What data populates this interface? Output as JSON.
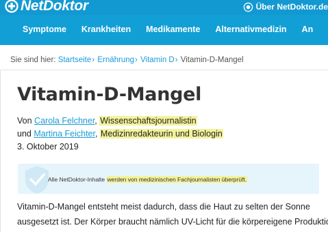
{
  "header": {
    "logo_text": "NetDoktor",
    "about_label": "Über NetDoktor.de"
  },
  "nav": {
    "home_icon": "home-icon",
    "items": [
      {
        "label": "Symptome"
      },
      {
        "label": "Krankheiten"
      },
      {
        "label": "Medikamente"
      },
      {
        "label": "Alternativmedizin"
      },
      {
        "label": "An"
      }
    ]
  },
  "breadcrumb": {
    "prefix": "Sie sind hier:",
    "links": [
      "Startseite",
      "Ernährung",
      "Vitamin D"
    ],
    "separator": "›",
    "current": "Vitamin-D-Mangel"
  },
  "article": {
    "title": "Vitamin-D-Mangel",
    "author1_prefix": "Von",
    "author1_name": "Carola Felchner",
    "author1_role": "Wissenschaftsjournalistin",
    "author2_prefix": "und",
    "author2_name": "Martina Feichter",
    "author2_role": "Medizinredakteurin und Biologin",
    "date": "3. Oktober 2019",
    "notice_prefix": "Alle NetDoktor-Inhalte",
    "notice_highlight": "werden von medizinischen Fachjournalisten überprüft.",
    "body_line1": "Vitamin-D-Mangel entsteht meist dadurch, dass die Haut zu selten der Sonne",
    "body_line2": "ausgesetzt ist. Der Körper braucht nämlich UV-Licht für die körpereigene Produktion"
  },
  "colors": {
    "brand_blue": "#129fd6",
    "link_blue": "#1a9bd6",
    "highlight_yellow": "#f3f29a",
    "notice_bg": "#e6f4fb"
  }
}
